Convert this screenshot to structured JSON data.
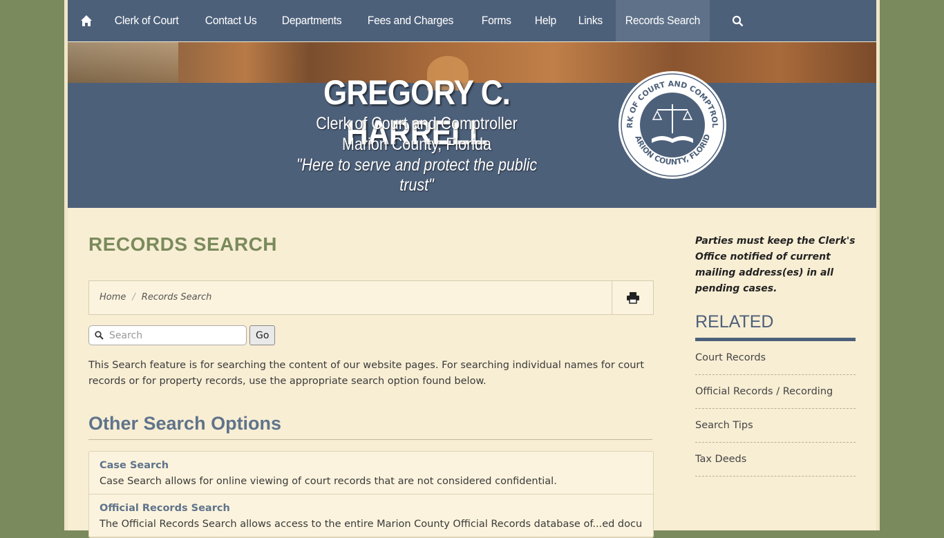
{
  "nav": {
    "items": [
      {
        "label": "Clerk of Court"
      },
      {
        "label": "Contact Us"
      },
      {
        "label": "Departments"
      },
      {
        "label": "Fees and Charges"
      },
      {
        "label": "Forms"
      },
      {
        "label": "Help"
      },
      {
        "label": "Links"
      },
      {
        "label": "Records Search"
      }
    ],
    "active": "Records Search"
  },
  "banner": {
    "name": "GREGORY C. HARRELL",
    "line1": "Clerk of Court and Comptroller",
    "line2": "Marion County, Florida",
    "motto": "\"Here to serve and protect the public trust\"",
    "seal_top": "CLERK OF COURT AND COMPTROLLER",
    "seal_bottom": "MARION COUNTY, FLORIDA"
  },
  "main": {
    "title": "RECORDS SEARCH",
    "breadcrumb": [
      "Home",
      "Records Search"
    ],
    "search": {
      "placeholder": "Search",
      "button": "Go"
    },
    "intro": "This Search feature is for searching the content of our website pages.  For searching individual names for court records or for property records, use the appropriate search option found below.",
    "other_heading": "Other Search Options",
    "options": [
      {
        "title": "Case Search",
        "desc": "Case Search allows for online viewing of court records that are not considered confidential."
      },
      {
        "title": "Official Records Search",
        "desc": "The Official Records Search allows access to the entire Marion County Official Records database of...ed documents"
      }
    ]
  },
  "sidebar": {
    "notice": "Parties must keep the Clerk's Office notified of current mailing address(es) in all pending cases.",
    "related_heading": "RELATED",
    "related": [
      {
        "label": "Court Records"
      },
      {
        "label": "Official Records / Recording"
      },
      {
        "label": "Search Tips"
      },
      {
        "label": "Tax Deeds"
      }
    ]
  },
  "colors": {
    "nav": "#4d607a",
    "page_bg": "#f8eed4",
    "outer_bg": "#7a8a5c",
    "title_green": "#7a8a5c",
    "heading_blue": "#5f738b"
  }
}
